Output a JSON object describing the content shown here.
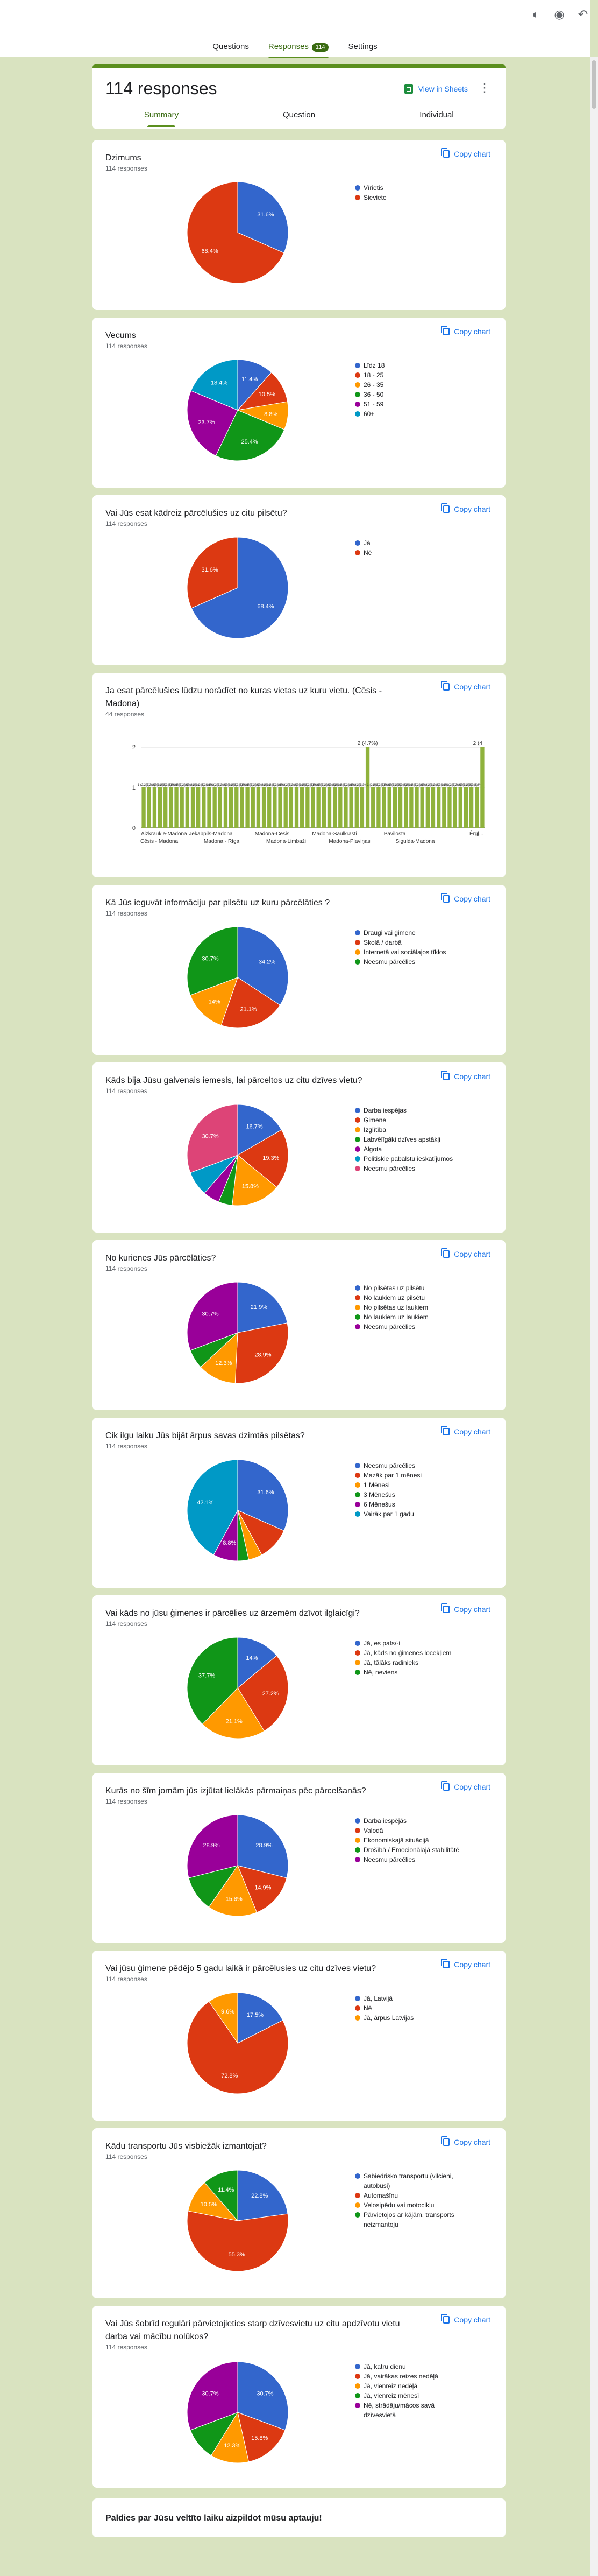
{
  "topbar": {
    "icons": [
      "palette-icon",
      "preview-icon",
      "undo-icon"
    ],
    "tabs": [
      {
        "label": "Questions"
      },
      {
        "label": "Responses",
        "badge": "114"
      },
      {
        "label": "Settings"
      }
    ]
  },
  "summary": {
    "title": "114 responses",
    "sheets_label": "View in Sheets",
    "tabs": [
      "Summary",
      "Question",
      "Individual"
    ]
  },
  "copy_label": "Copy chart",
  "colors": [
    "#3366cc",
    "#dc3912",
    "#ff9900",
    "#109618",
    "#990099",
    "#0099c6",
    "#dd4477"
  ],
  "questions": [
    {
      "title": "Dzimums",
      "count": "114 responses",
      "chart_data": {
        "type": "pie",
        "categories": [
          "Vīrietis",
          "Sieviete"
        ],
        "values": [
          31.6,
          68.4
        ],
        "labels": [
          "31.6%",
          "68.4%"
        ]
      }
    },
    {
      "title": "Vecums",
      "count": "114 responses",
      "chart_data": {
        "type": "pie",
        "categories": [
          "Līdz 18",
          "18 - 25",
          "26 - 35",
          "36 - 50",
          "51 - 59",
          "60+"
        ],
        "values": [
          11.4,
          10.5,
          8.8,
          25.4,
          23.7,
          18.4
        ],
        "labels": [
          "11.4%",
          "10.5%",
          "8.8%",
          "25.4%",
          "23.7%",
          "18.4%"
        ]
      }
    },
    {
      "title": "Vai Jūs esat kādreiz pārcēlušies uz citu pilsētu?",
      "count": "114 responses",
      "chart_data": {
        "type": "pie",
        "categories": [
          "Jā",
          "Nē"
        ],
        "values": [
          68.4,
          31.6
        ],
        "labels": [
          "68.4%",
          "31.6%"
        ]
      }
    },
    {
      "title": "Ja esat pārcēlušies lūdzu norādīet no kuras vietas uz kuru vietu. (Cēsis - Madona)",
      "count": "44 responses",
      "chart_data": {
        "type": "bar",
        "x_tick_labels_row1": [
          "Aizkraukle-Madona",
          "Jēkabpils-Madona",
          "Madona-Cēsis",
          "Madona-Saulkrasti",
          "Pāvilosta",
          "Ērgļ..."
        ],
        "x_tick_labels_row2": [
          "Cēsis - Madona",
          "Madona - Rīga",
          "Madona-Limbaži",
          "Madona-Pļaviņas",
          "Sigulda-Madona"
        ],
        "y_ticks": [
          "0",
          "1",
          "2"
        ],
        "ylim": [
          0,
          2
        ],
        "values": [
          1,
          1,
          1,
          1,
          1,
          1,
          1,
          1,
          1,
          1,
          1,
          1,
          1,
          1,
          1,
          1,
          1,
          1,
          1,
          1,
          1,
          1,
          1,
          1,
          1,
          1,
          1,
          1,
          1,
          1,
          1,
          1,
          1,
          1,
          1,
          1,
          1,
          1,
          1,
          1,
          1,
          2,
          1,
          1,
          1,
          1,
          1,
          1,
          1,
          1,
          1,
          1,
          1,
          1,
          1,
          1,
          1,
          1,
          1,
          1,
          1,
          1,
          2
        ],
        "bar_label_small": "1 (2.3%)",
        "bar_label_big": "2 (4.7%)",
        "bar_label_cut": "2 (4"
      }
    },
    {
      "title": "Kā Jūs ieguvāt informāciju par pilsētu uz kuru pārcēlāties ?",
      "count": "114 responses",
      "chart_data": {
        "type": "pie",
        "categories": [
          "Draugi vai ģimene",
          "Skolā / darbā",
          "Internetā vai sociālajos tīklos",
          "Neesmu pārcēlies"
        ],
        "values": [
          34.2,
          21.1,
          14,
          30.7
        ],
        "labels": [
          "34.2%",
          "21.1%",
          "14%",
          "30.7%"
        ]
      }
    },
    {
      "title": "Kāds bija Jūsu galvenais iemesls, lai pārceltos uz citu dzīves vietu?",
      "count": "114 responses",
      "chart_data": {
        "type": "pie",
        "categories": [
          "Darba iespējas",
          "Ģimene",
          "Izglītība",
          "Labvēlīgāki dzīves apstākļi",
          "Algota",
          "Politiskie pabalstu ieskatījumos",
          "Neesmu pārcēlies"
        ],
        "values": [
          16.7,
          19.3,
          15.8,
          4.4,
          5.3,
          7.9,
          30.7
        ],
        "labels": [
          "16.7%",
          "19.3%",
          "15.8%",
          "",
          "",
          "",
          "30.7%"
        ]
      }
    },
    {
      "title": "No kurienes Jūs pārcēlāties?",
      "count": "114 responses",
      "chart_data": {
        "type": "pie",
        "categories": [
          "No pilsētas uz pilsētu",
          "No laukiem uz pilsētu",
          "No pilsētas uz laukiem",
          "No laukiem uz laukiem",
          "Neesmu pārcēlies"
        ],
        "values": [
          21.9,
          28.9,
          12.3,
          6.2,
          30.7
        ],
        "labels": [
          "21.9%",
          "28.9%",
          "12.3%",
          "",
          "30.7%"
        ]
      }
    },
    {
      "title": "Cik ilgu laiku Jūs bijāt ārpus savas dzimtās pilsētas?",
      "count": "114 responses",
      "chart_data": {
        "type": "pie",
        "categories": [
          "Neesmu pārcēlies",
          "Mazāk par 1 mēnesi",
          "1 Mēnesi",
          "3 Mēnešus",
          "6 Mēnešus",
          "Vairāk par 1 gadu"
        ],
        "values": [
          31.6,
          10.5,
          4.4,
          3.5,
          7.9,
          42.1
        ],
        "labels": [
          "31.6%",
          "",
          "",
          "",
          "8.8%",
          "42.1%"
        ]
      }
    },
    {
      "title": "Vai kāds no jūsu ģimenes ir pārcēlies uz ārzemēm dzīvot ilglaicīgi?",
      "count": "114 responses",
      "chart_data": {
        "type": "pie",
        "categories": [
          "Jā, es pats/-i",
          "Jā, kāds no ģimenes locekļiem",
          "Jā, tālāks radinieks",
          "Nē, neviens"
        ],
        "values": [
          14,
          27.2,
          21.1,
          37.7
        ],
        "labels": [
          "14%",
          "27.2%",
          "21.1%",
          "37.7%"
        ]
      }
    },
    {
      "title": "Kurās no šīm jomām jūs izjūtat lielākās pārmaiņas pēc pārcelšanās?",
      "count": "114 responses",
      "chart_data": {
        "type": "pie",
        "categories": [
          "Darba iespējās",
          "Valodā",
          "Ekonomiskajā situācijā",
          "Drošībā / Emocionālajā stabilitātē",
          "Neesmu pārcēlies"
        ],
        "values": [
          28.9,
          14.9,
          15.8,
          11.4,
          28.9
        ],
        "labels": [
          "28.9%",
          "14.9%",
          "15.8%",
          "",
          "28.9%"
        ]
      }
    },
    {
      "title": "Vai jūsu ģimene pēdējo 5 gadu laikā ir pārcēlusies uz citu dzīves vietu?",
      "count": "114 responses",
      "chart_data": {
        "type": "pie",
        "categories": [
          "Jā, Latvijā",
          "Nē",
          "Jā, ārpus Latvijas"
        ],
        "values": [
          17.5,
          72.8,
          9.6
        ],
        "labels": [
          "17.5%",
          "72.8%",
          "9.6%"
        ]
      }
    },
    {
      "title": "Kādu transportu Jūs visbiežāk izmantojat?",
      "count": "114 responses",
      "chart_data": {
        "type": "pie",
        "categories": [
          "Sabiedrisko transportu (vilcieni, autobusi)",
          "Automašīnu",
          "Velosipēdu vai motociklu",
          "Pārvietojos ar kājām, transports neizmantoju"
        ],
        "values": [
          22.8,
          55.3,
          10.5,
          11.4
        ],
        "labels": [
          "22.8%",
          "55.3%",
          "10.5%",
          "11.4%"
        ]
      }
    },
    {
      "title": "Vai Jūs šobrīd regulāri pārvietojieties starp dzīvesvietu uz citu apdzīvotu vietu darba vai mācību nolūkos?",
      "count": "114 responses",
      "chart_data": {
        "type": "pie",
        "categories": [
          "Jā, katru dienu",
          "Jā, vairākas reizes nedēļā",
          "Jā, vienreiz nedēļā",
          "Jā, vienreiz mēnesī",
          "Nē, strādāju/mācos savā dzīvesvietā"
        ],
        "values": [
          30.7,
          15.8,
          12.3,
          10.5,
          30.7
        ],
        "labels": [
          "30.7%",
          "15.8%",
          "12.3%",
          "",
          "30.7%"
        ]
      }
    }
  ],
  "thanks": "Paldies par Jūsu veltīto laiku aizpildot mūsu aptauju!"
}
